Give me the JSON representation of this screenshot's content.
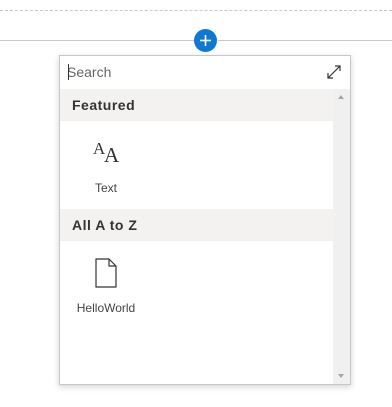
{
  "colors": {
    "accent": "#0f78d4",
    "section_bg": "#f3f2f1",
    "panel_border": "#c8c8c8",
    "text": "#333333"
  },
  "add_button": {
    "icon": "plus-icon"
  },
  "picker": {
    "search": {
      "placeholder": "Search",
      "value": ""
    },
    "expand_icon": "expand-icon",
    "sections": [
      {
        "title": "Featured",
        "items": [
          {
            "label": "Text",
            "icon": "text-font-icon"
          }
        ]
      },
      {
        "title": "All A to Z",
        "items": [
          {
            "label": "HelloWorld",
            "icon": "document-icon"
          }
        ]
      }
    ]
  }
}
